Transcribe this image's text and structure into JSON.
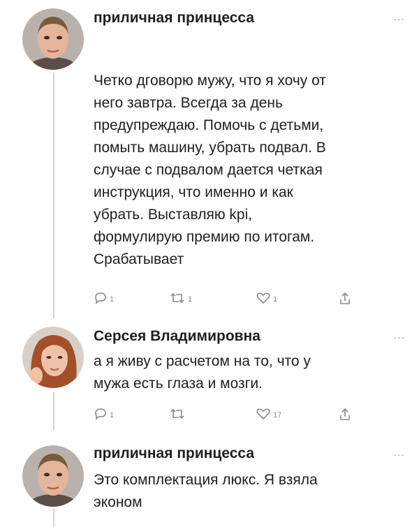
{
  "tweets": [
    {
      "author": "приличная принцесса",
      "more": "...",
      "lines": [
        "Четко дговорю мужу, что я хочу от",
        "него завтра. Всегда за день",
        "предупреждаю. Помочь с детьми,",
        "помыть машину, убрать подвал. В",
        "случае с подвалом дается четкая",
        "инструкция, что именно и как",
        "убрать.  Выставляю kpi,",
        "формулирую премию по итогам.",
        "Срабатывает"
      ],
      "actions": {
        "reply": "1",
        "retweet": "1",
        "like": "1",
        "share": ""
      }
    },
    {
      "author": "Серсея Владимировна",
      "more": "...",
      "lines": [
        "а я живу с расчетом на то, что у",
        "мужа есть глаза и мозги."
      ],
      "actions": {
        "reply": "1",
        "retweet": "",
        "like": "17",
        "share": ""
      }
    },
    {
      "author": "приличная принцесса",
      "more": "...",
      "lines": [
        "Это комплектация люкс. Я взяла",
        "эконом"
      ]
    }
  ],
  "colors": {
    "text": "#1f1f1f",
    "muted": "#8a8a8a",
    "thread_line": "#d6d6d6"
  },
  "icons": [
    "reply-icon",
    "retweet-icon",
    "like-icon",
    "share-icon",
    "more-icon"
  ]
}
